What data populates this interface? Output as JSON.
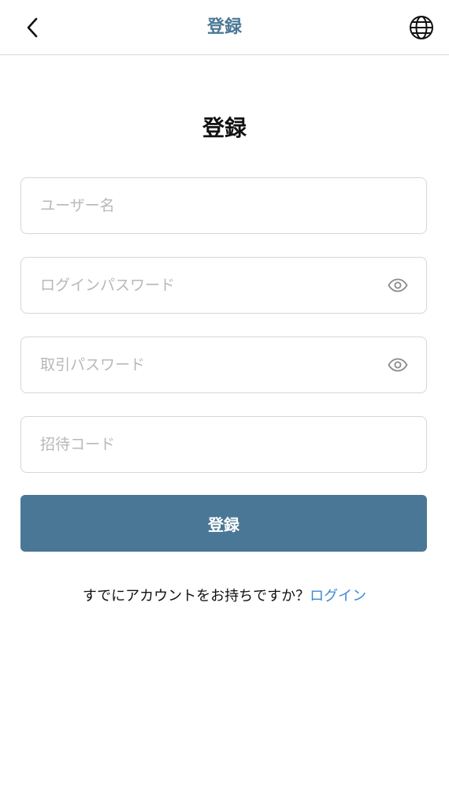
{
  "header": {
    "title": "登録"
  },
  "page": {
    "title": "登録"
  },
  "form": {
    "username": {
      "placeholder": "ユーザー名",
      "value": ""
    },
    "login_password": {
      "placeholder": "ログインパスワード",
      "value": ""
    },
    "trade_password": {
      "placeholder": "取引パスワード",
      "value": ""
    },
    "invite_code": {
      "placeholder": "招待コード",
      "value": ""
    },
    "submit_label": "登録"
  },
  "footer": {
    "prompt": "すでにアカウントをお持ちですか？",
    "login_link": "ログイン"
  },
  "colors": {
    "accent": "#4a7795",
    "link": "#3a8ad6",
    "border": "#d6d6d6",
    "placeholder": "#b8b8b8"
  },
  "icons": {
    "back": "chevron-left-icon",
    "language": "globe-icon",
    "password_toggle": "eye-icon"
  }
}
